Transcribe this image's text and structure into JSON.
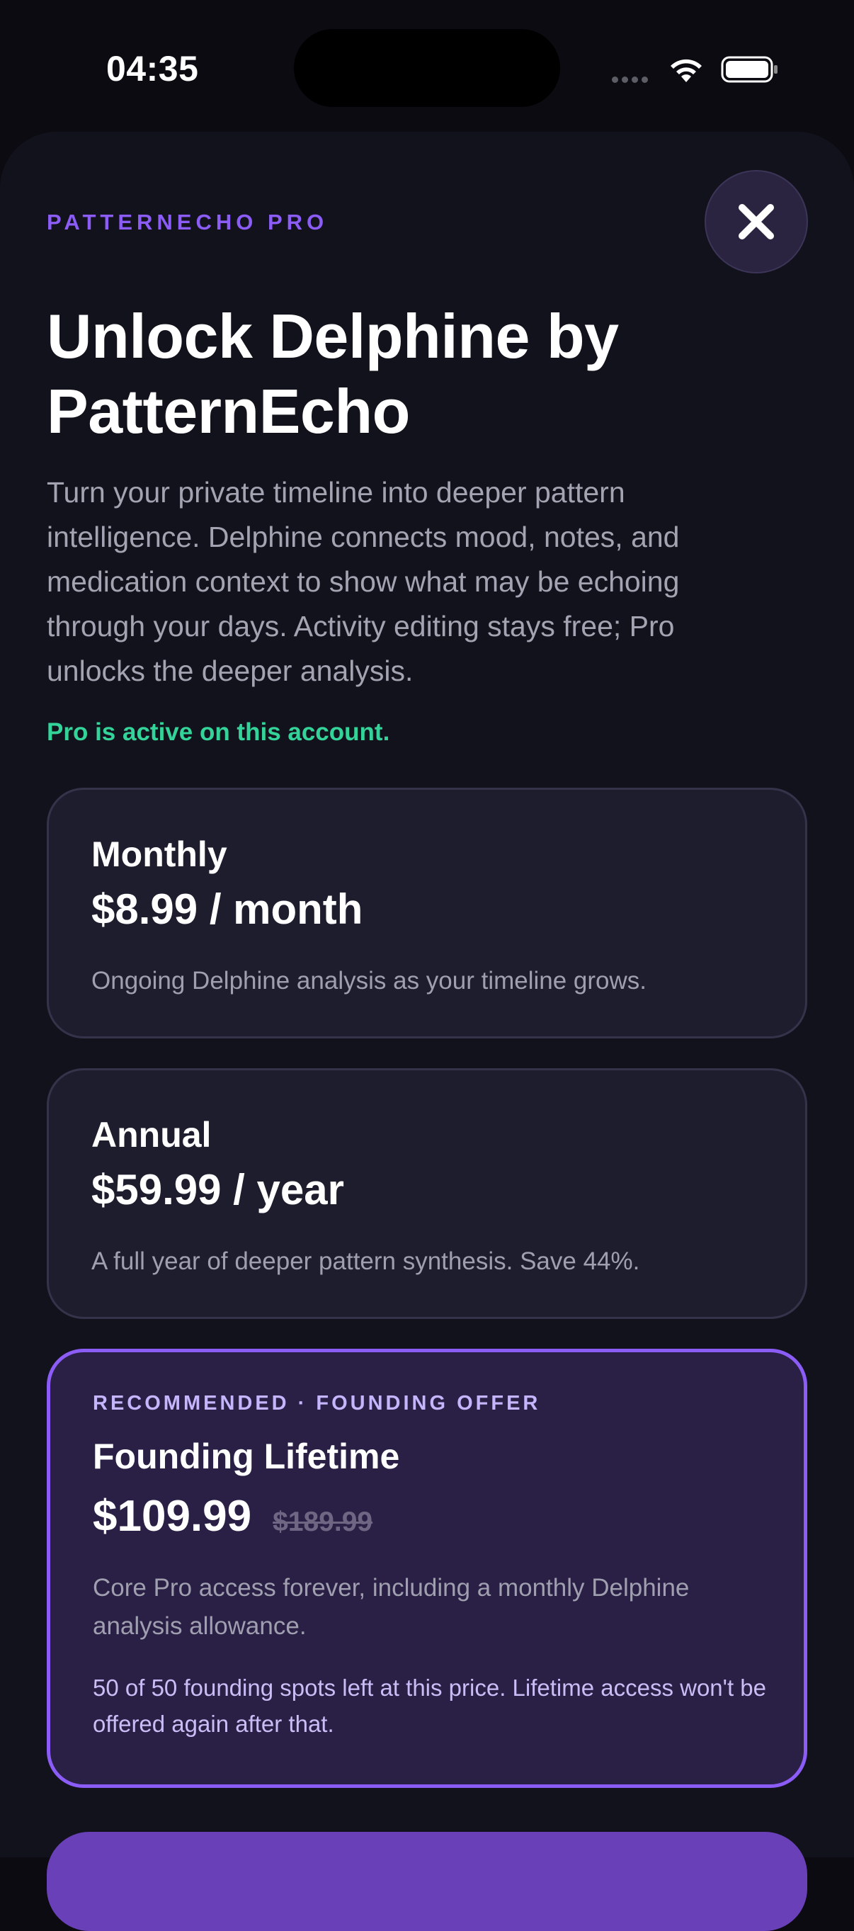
{
  "status_bar": {
    "time": "04:35"
  },
  "header": {
    "eyebrow": "PATTERNECHO PRO",
    "title": "Unlock Delphine by PatternEcho",
    "description": "Turn your private timeline into deeper pattern intelligence. Delphine connects mood, notes, and medication context to show what may be echoing through your days. Activity editing stays free; Pro unlocks the deeper analysis.",
    "pro_status": "Pro is active on this account."
  },
  "plans": [
    {
      "name": "Monthly",
      "price": "$8.99 / month",
      "description": "Ongoing Delphine analysis as your timeline grows."
    },
    {
      "name": "Annual",
      "price": "$59.99 / year",
      "description": "A full year of deeper pattern synthesis. Save 44%."
    },
    {
      "badge": "RECOMMENDED · FOUNDING OFFER",
      "name": "Founding Lifetime",
      "price": "$109.99",
      "original_price": "$189.99",
      "description": "Core Pro access forever, including a monthly Delphine analysis allowance.",
      "note": "50 of 50 founding spots left at this price. Lifetime access won't be offered again after that."
    }
  ],
  "colors": {
    "accent": "#8b5cf6",
    "success": "#34d399",
    "background": "#12121c"
  },
  "icons": {
    "close": "close-icon",
    "wifi": "wifi-icon",
    "battery": "battery-icon",
    "signal": "signal-icon"
  }
}
